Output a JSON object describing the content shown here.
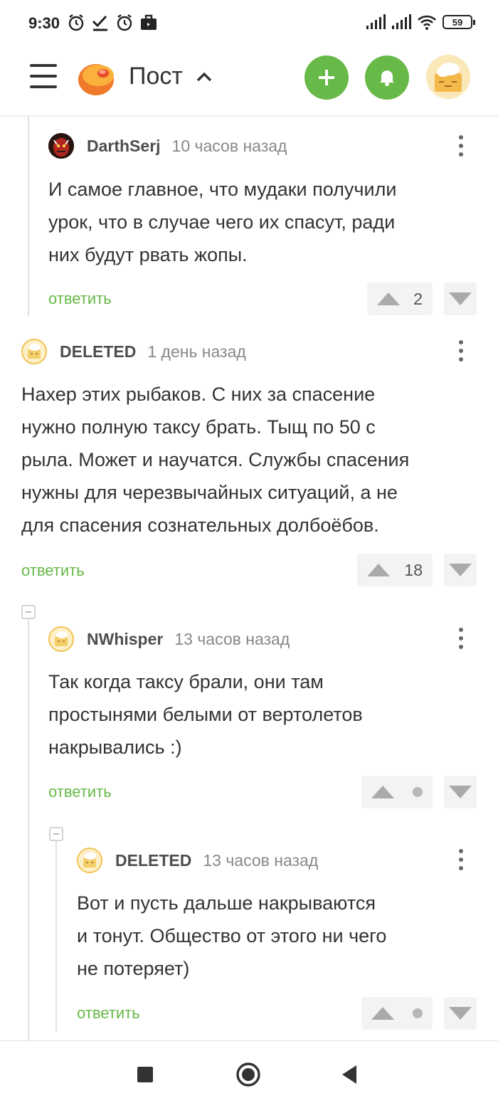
{
  "status_bar": {
    "time": "9:30",
    "battery": "59",
    "icons_left": [
      "alarm-icon",
      "check-icon",
      "alarm-icon",
      "briefcase-icon"
    ],
    "icons_right": [
      "signal-icon",
      "signal-icon",
      "wifi-icon",
      "battery-icon"
    ]
  },
  "header": {
    "title": "Пост",
    "icons": [
      "menu-icon",
      "logo-icon",
      "chevron-up-icon",
      "plus-icon",
      "bell-icon",
      "avatar"
    ],
    "accent_color": "#67b948"
  },
  "comments": [
    {
      "author": "DarthSerj",
      "time": "10 часов назад",
      "text": [
        "И самое главное, что мудаки получили",
        "урок, что в случае чего их спасут, ради",
        "них будут рвать жопы."
      ],
      "reply_label": "ответить",
      "rating": "2"
    },
    {
      "author": "DELETED",
      "time": "1 день назад",
      "text": [
        "Нахер этих рыбаков. С них за спасение",
        "нужно полную таксу брать. Тыщ по 50 с",
        "рыла. Может и научатся. Службы спасения",
        "нужны для черезвычайных ситуаций, а не",
        "для спасения сознательных долбоёбов."
      ],
      "reply_label": "ответить",
      "rating": "18"
    },
    {
      "author": "NWhisper",
      "time": "13 часов назад",
      "text": [
        "Так когда таксу брали, они там",
        "простынями белыми от вертолетов",
        "накрывались :)"
      ],
      "reply_label": "ответить",
      "rating": ""
    },
    {
      "author": "DELETED",
      "time": "13 часов назад",
      "text": [
        "Вот и пусть дальше накрываются",
        "и тонут. Общество от этого ни чего",
        "не потеряет)"
      ],
      "reply_label": "ответить",
      "rating": ""
    }
  ],
  "nav_bar": {
    "icons": [
      "recents-square-icon",
      "home-circle-icon",
      "back-triangle-icon"
    ]
  }
}
